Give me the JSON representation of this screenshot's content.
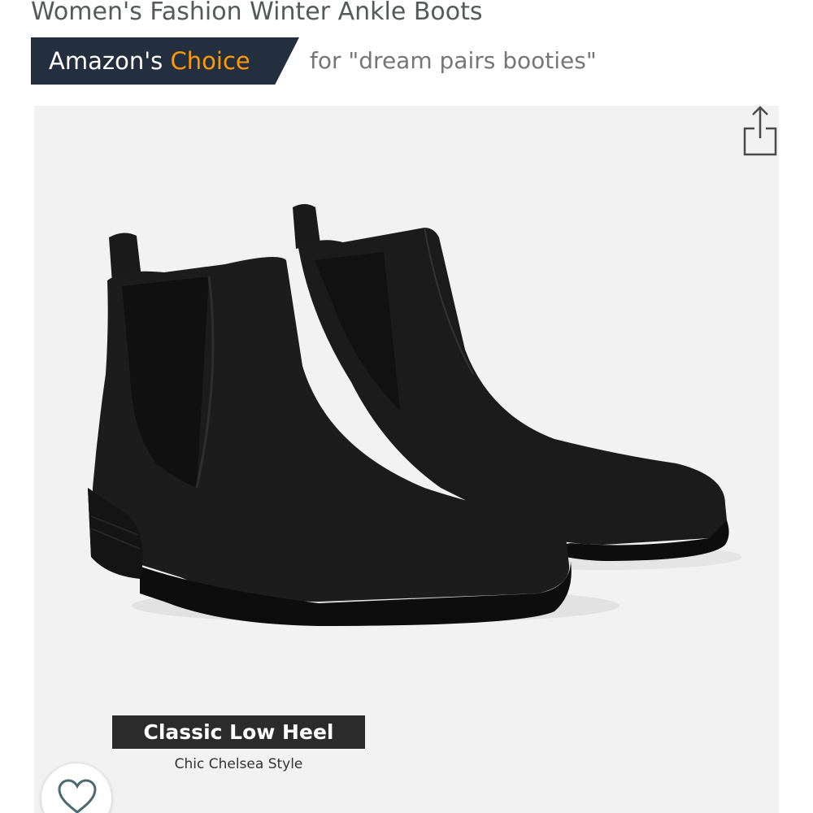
{
  "product": {
    "title": "Women's Fashion Winter Ankle Boots"
  },
  "badge": {
    "prefix": "Amazon's",
    "highlight": "Choice",
    "query": "for \"dream pairs booties\"",
    "colors": {
      "background": "#232f3e",
      "accent": "#ff9900"
    }
  },
  "image": {
    "caption_title": "Classic Low Heel",
    "caption_subtitle": "Chic Chelsea Style"
  },
  "icons": {
    "share": "share-icon",
    "favorite": "heart-icon"
  }
}
